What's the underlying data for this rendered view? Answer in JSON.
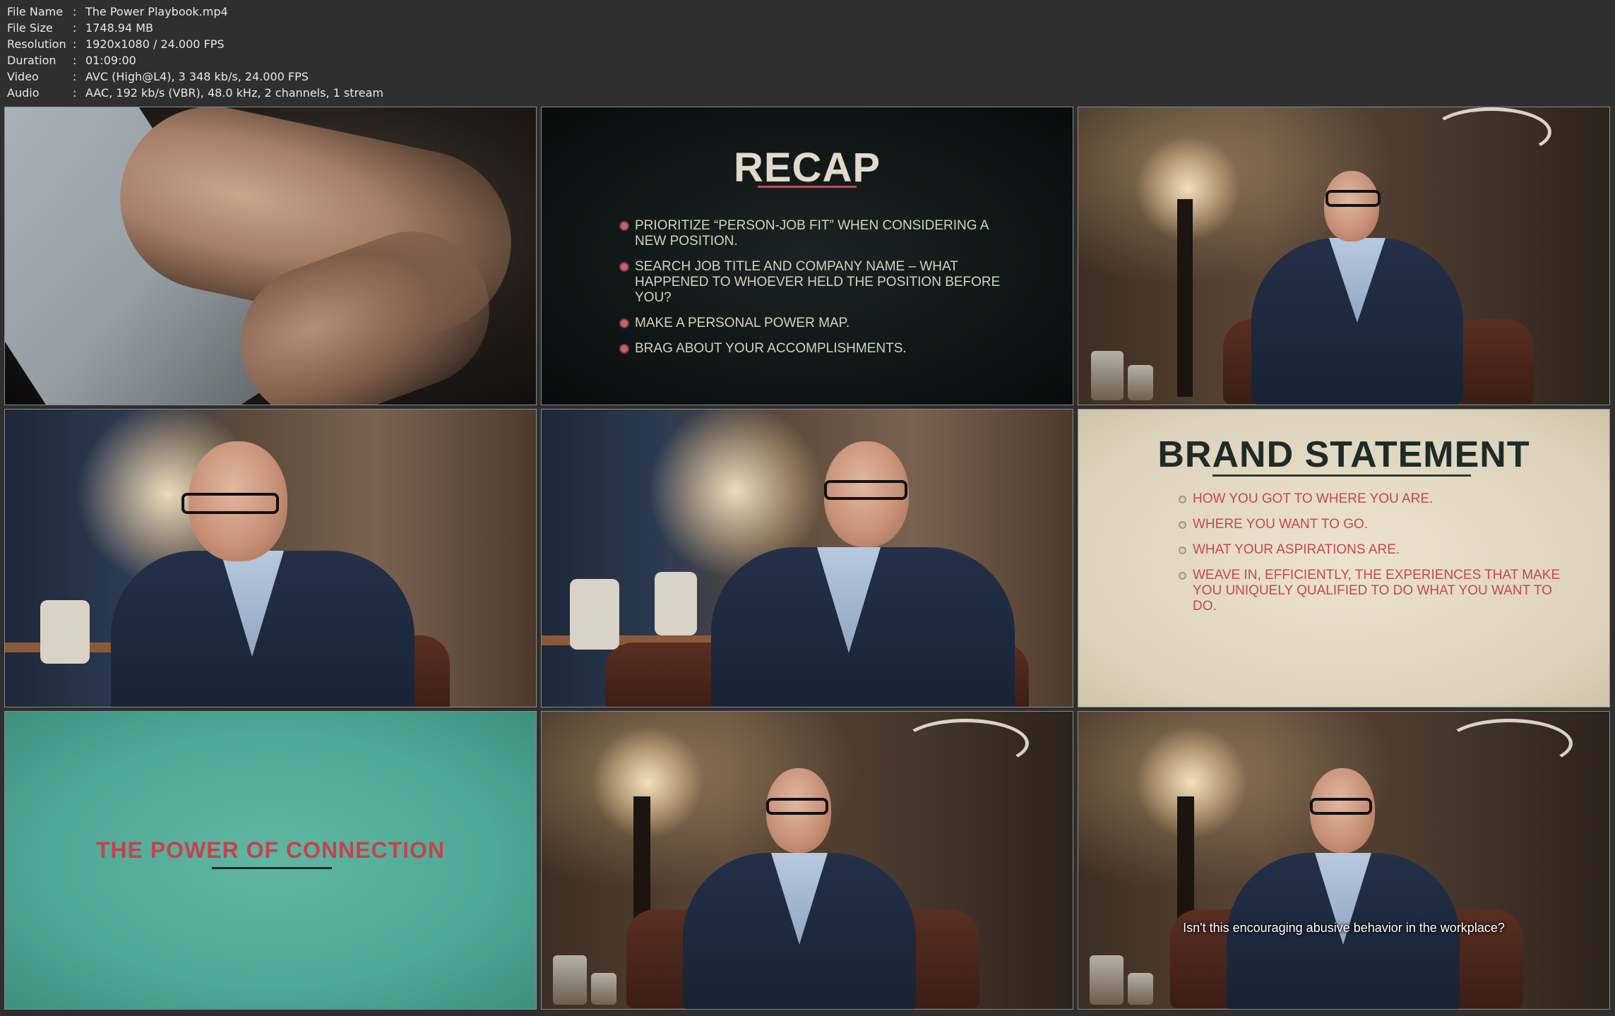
{
  "info": [
    {
      "label": "File Name",
      "value": "The Power Playbook.mp4"
    },
    {
      "label": "File Size",
      "value": "1748.94 MB"
    },
    {
      "label": "Resolution",
      "value": "1920x1080 / 24.000 FPS"
    },
    {
      "label": "Duration",
      "value": "01:09:00"
    },
    {
      "label": "Video",
      "value": "AVC (High@L4), 3 348 kb/s, 24.000 FPS"
    },
    {
      "label": "Audio",
      "value": "AAC, 192 kb/s (VBR), 48.0 kHz, 2 channels, 1 stream"
    }
  ],
  "separator": ":",
  "recap": {
    "title": "RECAP",
    "items": [
      "PRIORITIZE “PERSON-JOB FIT” WHEN CONSIDERING A NEW POSITION.",
      "SEARCH JOB TITLE AND COMPANY NAME – WHAT HAPPENED TO WHOEVER HELD THE POSITION BEFORE YOU?",
      "MAKE A PERSONAL POWER MAP.",
      "BRAG ABOUT YOUR ACCOMPLISHMENTS."
    ]
  },
  "brand": {
    "title": "BRAND STATEMENT",
    "items": [
      "HOW YOU GOT TO WHERE YOU ARE.",
      "WHERE YOU WANT TO GO.",
      "WHAT YOUR ASPIRATIONS ARE.",
      "WEAVE IN, EFFICIENTLY, THE EXPERIENCES THAT MAKE YOU UNIQUELY QUALIFIED TO DO WHAT YOU WANT TO DO."
    ]
  },
  "connection": {
    "title": "THE POWER OF CONNECTION"
  },
  "subtitle": "Isn't this encouraging abusive behavior in the workplace?",
  "colors": {
    "background": "#2f2f2f",
    "accent_red": "#c44a52",
    "teal": "#4ea895"
  }
}
